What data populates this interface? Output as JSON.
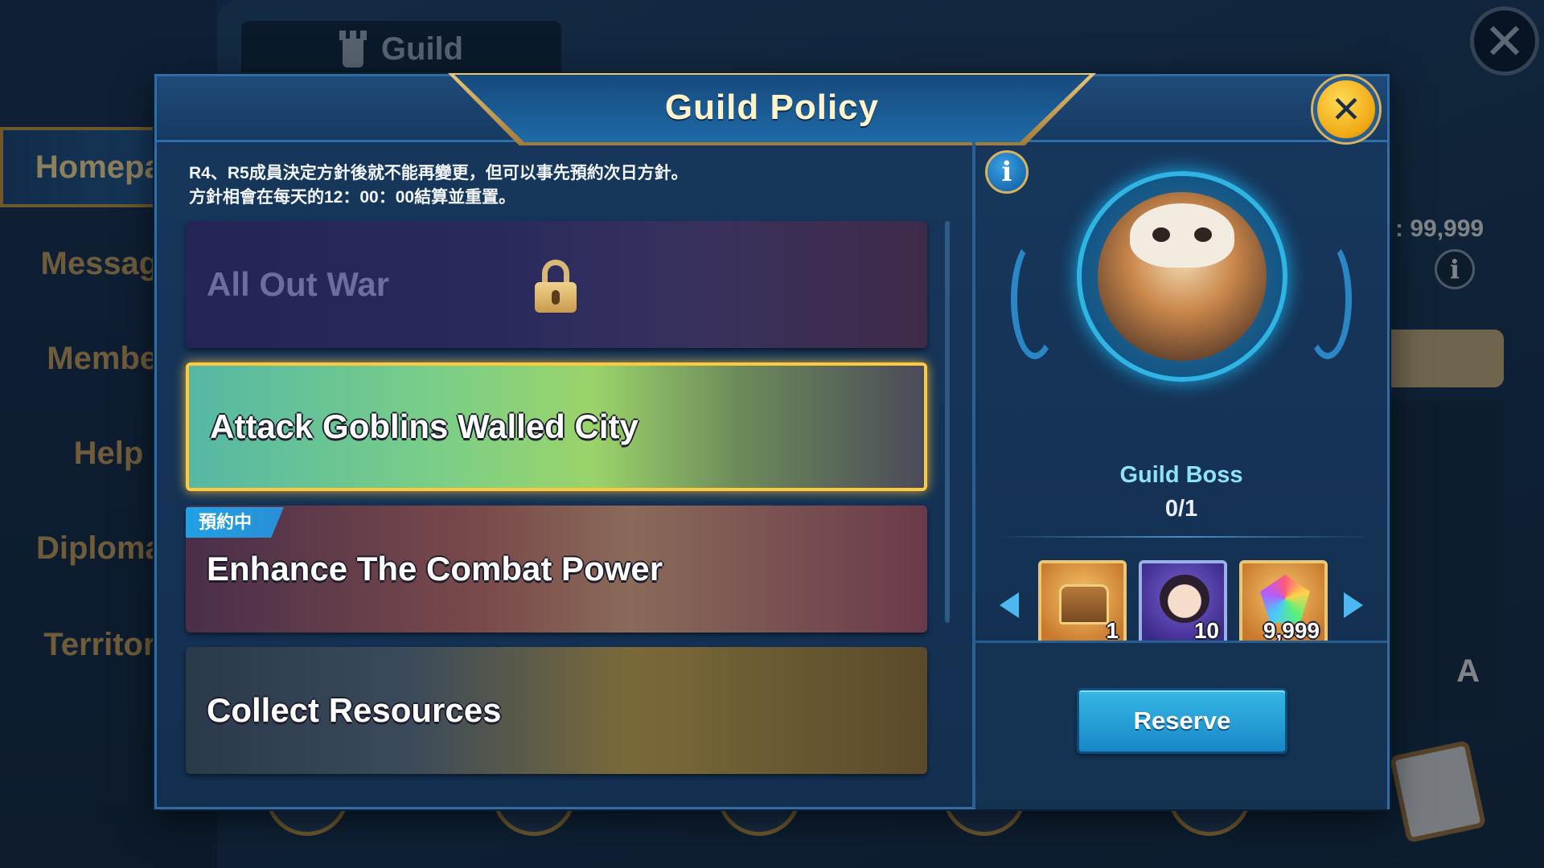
{
  "background": {
    "tab_title": "Guild",
    "nav": [
      {
        "label": "Homepag",
        "active": true
      },
      {
        "label": "Message",
        "active": false
      },
      {
        "label": "Member",
        "active": false
      },
      {
        "label": "Help",
        "active": false
      },
      {
        "label": "Diplomac",
        "active": false
      },
      {
        "label": "Territory",
        "active": false
      }
    ],
    "currency_value": ": 99,999",
    "info_glyph": "i",
    "translate_glyph": "A"
  },
  "modal": {
    "title": "Guild Policy",
    "close_glyph": "✕",
    "notice_line1": "R4、R5成員決定方針後就不能再變更，但可以事先預約次日方針。",
    "notice_line2": "方針相會在每天的12：00：00結算並重置。",
    "policies": [
      {
        "name": "All Out War",
        "locked": true
      },
      {
        "name": "Attack Goblins Walled City",
        "selected": true
      },
      {
        "name": "Enhance The Combat Power",
        "tag": "預約中"
      },
      {
        "name": "Collect Resources"
      }
    ],
    "detail": {
      "info_glyph": "i",
      "boss_label": "Guild Boss",
      "boss_count": "0/1",
      "rewards": [
        {
          "icon": "treasure-chest-icon",
          "quantity": "1"
        },
        {
          "icon": "hero-portrait-icon",
          "quantity": "10"
        },
        {
          "icon": "rainbow-gem-icon",
          "quantity": "9,999"
        }
      ],
      "reserve_label": "Reserve"
    }
  },
  "colors": {
    "accent_gold": "#ffc93e",
    "button_blue": "#1887c6",
    "title_text": "#fff3c9",
    "boss_text": "#8fe3f7"
  }
}
